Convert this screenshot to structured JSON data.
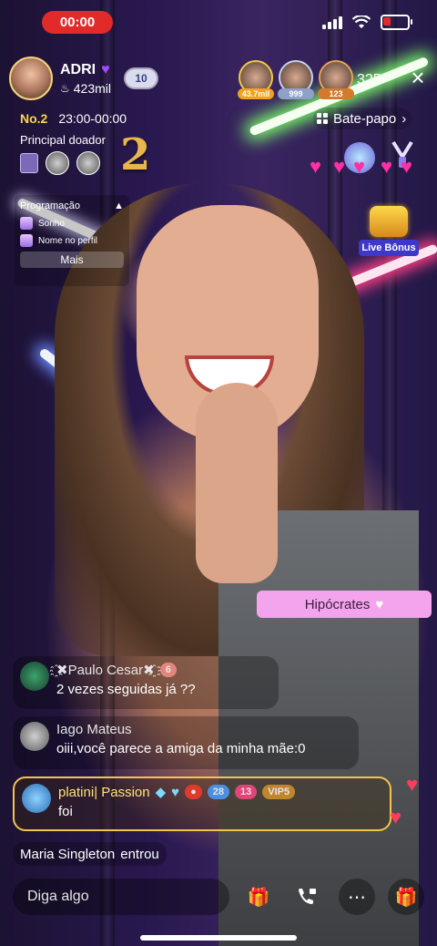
{
  "status_bar": {
    "recording_time": "00:00"
  },
  "host": {
    "name": "ADRI",
    "fans": "423mil",
    "level": "10"
  },
  "top_viewers": [
    {
      "tag": "43.7mil",
      "tag_color": "#f2a21b"
    },
    {
      "tag": "999",
      "tag_color": "#8fa1c9"
    },
    {
      "tag": "123",
      "tag_color": "#d57a2c"
    }
  ],
  "viewer_count": "325",
  "rank": {
    "position": "No.2",
    "time_range": "23:00-00:00"
  },
  "donors": {
    "label": "Principal doador",
    "place_number": "2"
  },
  "chat_button": {
    "label": "Bate-papo"
  },
  "live_bonus": {
    "label": "Live Bônus"
  },
  "program": {
    "title": "Programação",
    "items": [
      "Sonho",
      "Nome no perfil"
    ],
    "more_label": "Mais"
  },
  "highlight_message": {
    "text": "Hipócrates"
  },
  "comments": [
    {
      "name": "҈✖Paulo Cesar✖҈",
      "text": "2 vezes seguidas já ??",
      "badge": "6"
    },
    {
      "name": "Iago Mateus",
      "text": "oiii,você parece a amiga da minha mãe:0"
    },
    {
      "name": "platini| Passion",
      "text": "foi",
      "badges": [
        "28",
        "13",
        "VIP5"
      ]
    }
  ],
  "join_notice": {
    "name": "Maria Singleton",
    "action": "entrou"
  },
  "input": {
    "placeholder": "Diga algo"
  },
  "colors": {
    "accent_pink": "#f4a4ec",
    "record_red": "#e12a2a",
    "gold": "#f2c44c"
  }
}
